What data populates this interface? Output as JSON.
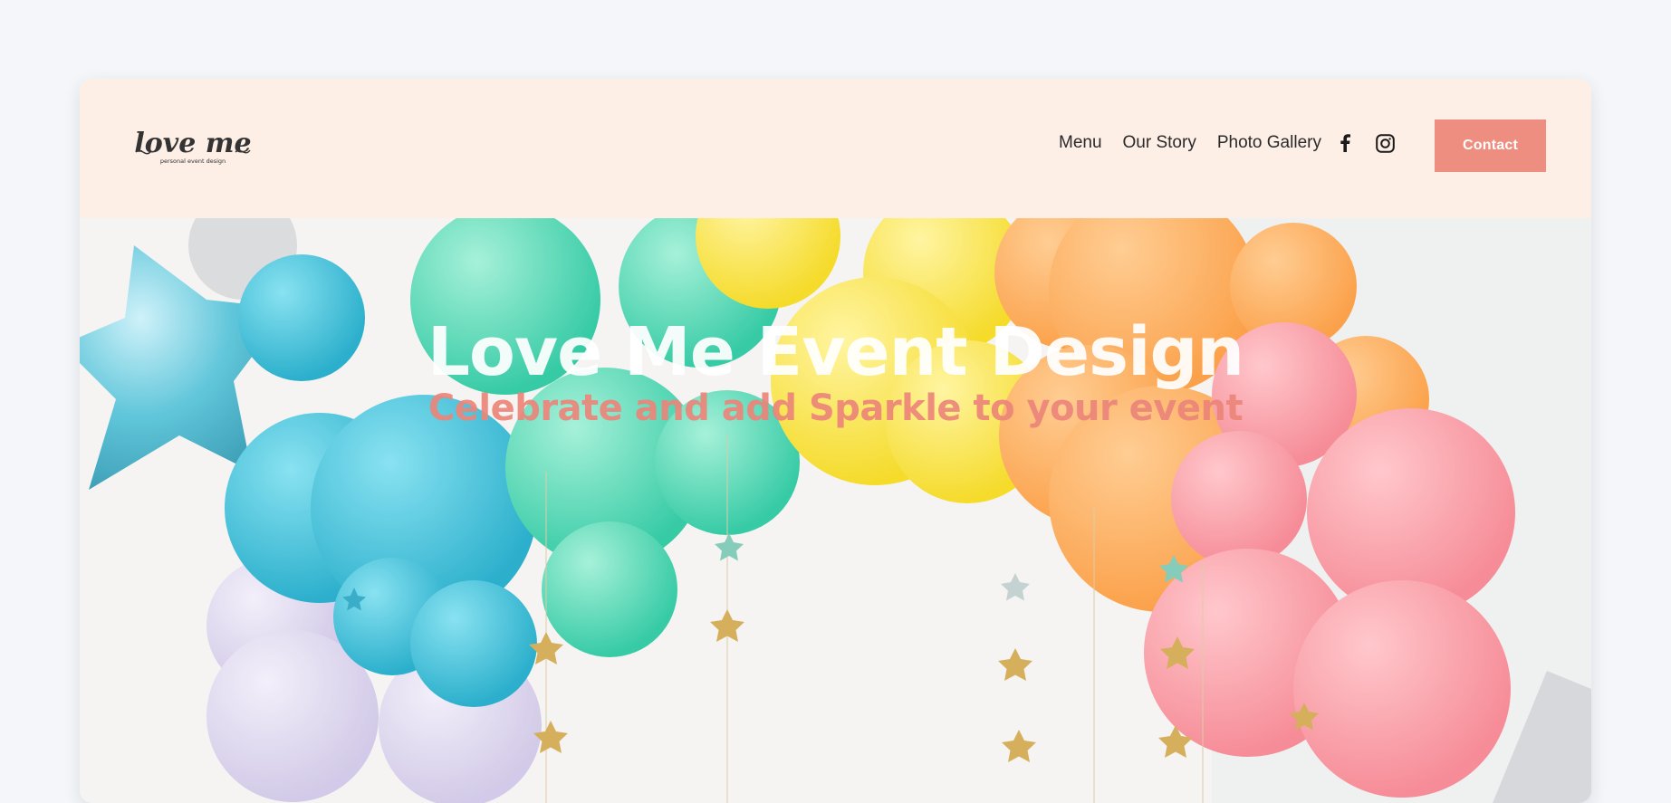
{
  "brand": {
    "logo_text": "love me",
    "logo_tagline": "personal event design"
  },
  "nav": {
    "items": [
      {
        "label": "Menu"
      },
      {
        "label": "Our Story"
      },
      {
        "label": "Photo Gallery"
      }
    ]
  },
  "social": {
    "icons": [
      "facebook-icon",
      "instagram-icon"
    ]
  },
  "header": {
    "contact_label": "Contact"
  },
  "hero": {
    "title": "Love Me Event Design",
    "subtitle": "Celebrate and add Sparkle to your event"
  },
  "colors": {
    "header_bg": "#fdeee6",
    "accent": "#ee8e80",
    "title": "#ffffff",
    "subtitle": "#ec847a"
  }
}
